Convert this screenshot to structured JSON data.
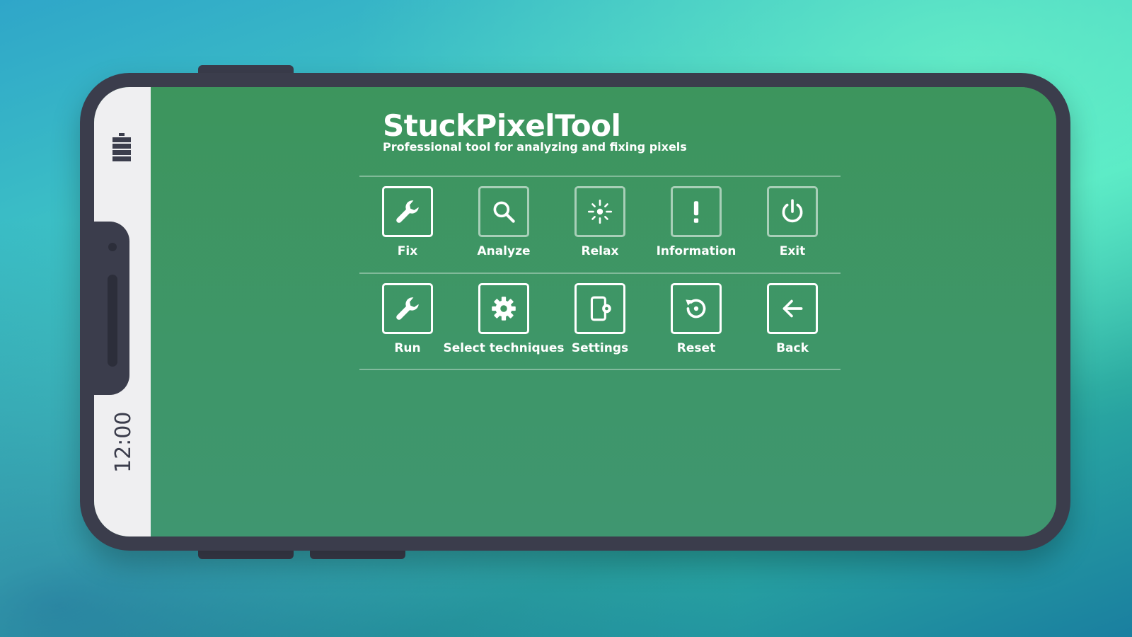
{
  "app": {
    "title": "StuckPixelTool",
    "subtitle": "Professional tool for analyzing and fixing pixels"
  },
  "status_bar": {
    "time": "12:00",
    "battery_icon": "battery-icon"
  },
  "menu": {
    "rows": [
      [
        {
          "label": "Fix",
          "icon": "wrench-icon"
        },
        {
          "label": "Analyze",
          "icon": "magnifier-icon"
        },
        {
          "label": "Relax",
          "icon": "sparkle-icon"
        },
        {
          "label": "Information",
          "icon": "exclamation-icon"
        },
        {
          "label": "Exit",
          "icon": "power-icon"
        }
      ],
      [
        {
          "label": "Run",
          "icon": "wrench-icon"
        },
        {
          "label": "Select techniques",
          "icon": "gear-icon"
        },
        {
          "label": "Settings",
          "icon": "device-settings-icon"
        },
        {
          "label": "Reset",
          "icon": "reset-icon"
        },
        {
          "label": "Back",
          "icon": "arrow-left-icon"
        }
      ]
    ]
  },
  "colors": {
    "screen_green": "#3e9660",
    "phone_frame": "#3b3d4c",
    "status_strip": "#efeff1",
    "icon_white": "#ffffff"
  }
}
